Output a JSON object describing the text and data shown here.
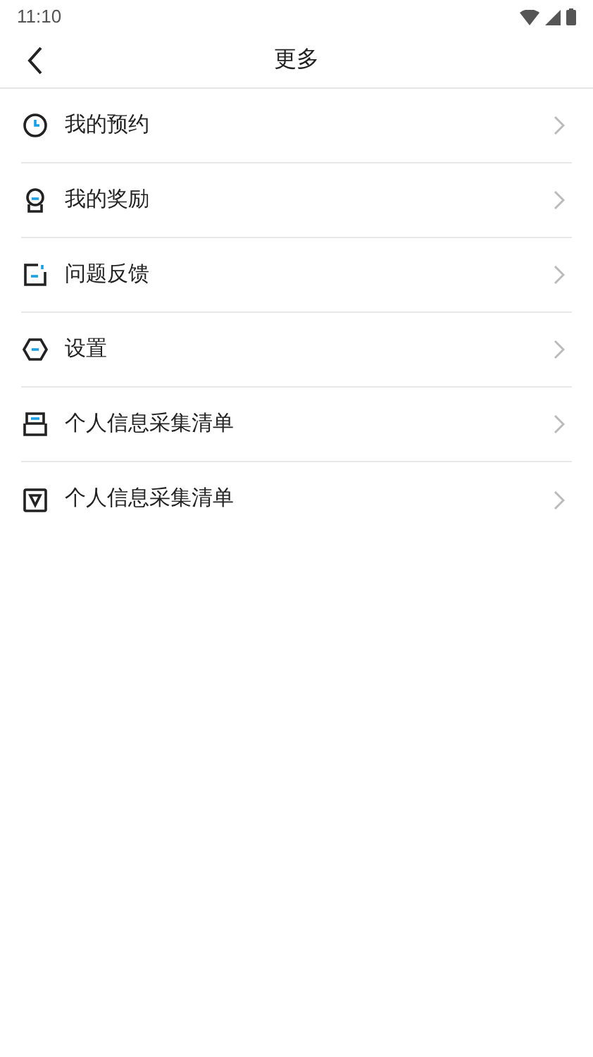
{
  "status_bar": {
    "time": "11:10"
  },
  "header": {
    "title": "更多"
  },
  "menu": [
    {
      "kind": "clock",
      "label": "我的预约"
    },
    {
      "kind": "medal",
      "label": "我的奖励"
    },
    {
      "kind": "feedback",
      "label": "问题反馈"
    },
    {
      "kind": "settings",
      "label": "设置"
    },
    {
      "kind": "inbox",
      "label": "个人信息采集清单"
    },
    {
      "kind": "triangle",
      "label": "个人信息采集清单"
    }
  ]
}
